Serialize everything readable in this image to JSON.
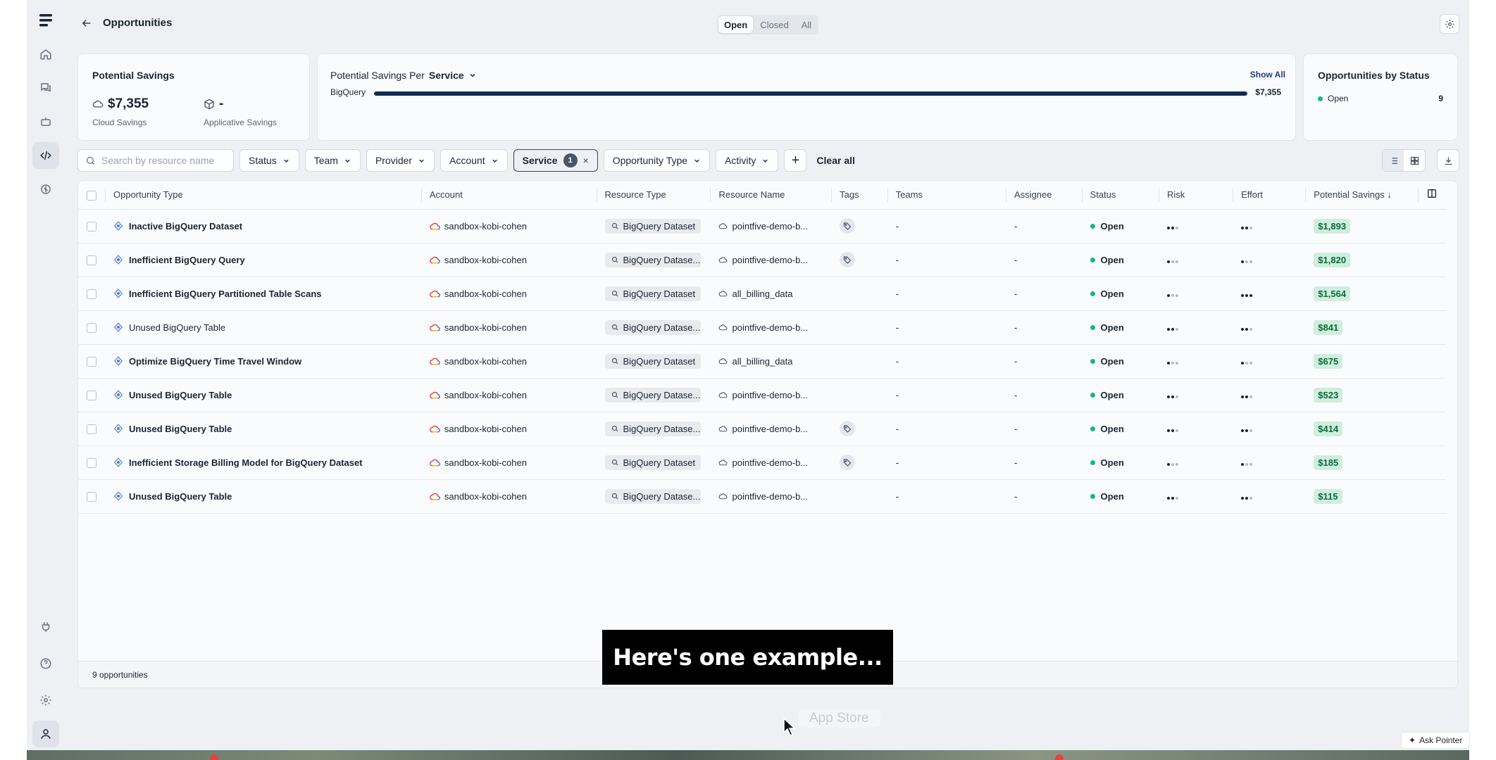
{
  "app": {
    "page_title": "Opportunities",
    "view_tabs": [
      {
        "label": "Open",
        "selected": true
      },
      {
        "label": "Closed",
        "selected": false
      },
      {
        "label": "All",
        "selected": false
      }
    ]
  },
  "potential_savings": {
    "title": "Potential Savings",
    "cloud_value": "$7,355",
    "cloud_label": "Cloud Savings",
    "applicative_value": "-",
    "applicative_label": "Applicative Savings"
  },
  "savings_per": {
    "title": "Potential Savings Per",
    "group_by": "Service",
    "show_all": "Show All",
    "bar": {
      "label": "BigQuery",
      "value": "$7,355",
      "fraction": 1.0
    }
  },
  "status_summary": {
    "title": "Opportunities by Status",
    "items": [
      {
        "label": "Open",
        "count": "9",
        "color": "#10b981"
      }
    ]
  },
  "filters": {
    "search_placeholder": "Search by resource name",
    "buttons": [
      "Status",
      "Team",
      "Provider",
      "Account"
    ],
    "active_filter": {
      "label": "Service",
      "count": "1",
      "remove": "×"
    },
    "more_buttons": [
      "Opportunity Type",
      "Activity"
    ],
    "add": "+",
    "clear_all": "Clear all"
  },
  "table": {
    "columns": [
      "Opportunity Type",
      "Account",
      "Resource Type",
      "Resource Name",
      "Tags",
      "Teams",
      "Assignee",
      "Status",
      "Risk",
      "Effort",
      "Potential Savings"
    ],
    "sort_indicator": "↓",
    "rows": [
      {
        "type": "Inactive BigQuery Dataset",
        "bold": true,
        "account": "sandbox-kobi-cohen",
        "resource_type": "BigQuery Dataset",
        "resource_name": "pointfive-demo-b...",
        "tag": true,
        "teams": "-",
        "assignee": "-",
        "status": "Open",
        "risk": 2,
        "effort": 2,
        "savings": "$1,893"
      },
      {
        "type": "Inefficient BigQuery Query",
        "bold": true,
        "account": "sandbox-kobi-cohen",
        "resource_type": "BigQuery Datase...",
        "resource_name": "pointfive-demo-b...",
        "tag": true,
        "teams": "-",
        "assignee": "-",
        "status": "Open",
        "risk": 1,
        "effort": 1,
        "savings": "$1,820"
      },
      {
        "type": "Inefficient BigQuery Partitioned Table Scans",
        "bold": true,
        "account": "sandbox-kobi-cohen",
        "resource_type": "BigQuery Dataset",
        "resource_name": "all_billing_data",
        "tag": false,
        "teams": "-",
        "assignee": "-",
        "status": "Open",
        "risk": 1,
        "effort": 3,
        "savings": "$1,564"
      },
      {
        "type": "Unused BigQuery Table",
        "bold": false,
        "account": "sandbox-kobi-cohen",
        "resource_type": "BigQuery Datase...",
        "resource_name": "pointfive-demo-b...",
        "tag": false,
        "teams": "-",
        "assignee": "-",
        "status": "Open",
        "risk": 2,
        "effort": 2,
        "savings": "$841"
      },
      {
        "type": "Optimize BigQuery Time Travel Window",
        "bold": true,
        "account": "sandbox-kobi-cohen",
        "resource_type": "BigQuery Dataset",
        "resource_name": "all_billing_data",
        "tag": false,
        "teams": "-",
        "assignee": "-",
        "status": "Open",
        "risk": 1,
        "effort": 1,
        "savings": "$675"
      },
      {
        "type": "Unused BigQuery Table",
        "bold": true,
        "account": "sandbox-kobi-cohen",
        "resource_type": "BigQuery Datase...",
        "resource_name": "pointfive-demo-b...",
        "tag": false,
        "teams": "-",
        "assignee": "-",
        "status": "Open",
        "risk": 2,
        "effort": 2,
        "savings": "$523"
      },
      {
        "type": "Unused BigQuery Table",
        "bold": true,
        "account": "sandbox-kobi-cohen",
        "resource_type": "BigQuery Datase...",
        "resource_name": "pointfive-demo-b...",
        "tag": true,
        "teams": "-",
        "assignee": "-",
        "status": "Open",
        "risk": 2,
        "effort": 2,
        "savings": "$414"
      },
      {
        "type": "Inefficient Storage Billing Model for BigQuery Dataset",
        "bold": true,
        "account": "sandbox-kobi-cohen",
        "resource_type": "BigQuery Dataset",
        "resource_name": "pointfive-demo-b...",
        "tag": true,
        "teams": "-",
        "assignee": "-",
        "status": "Open",
        "risk": 1,
        "effort": 1,
        "savings": "$185"
      },
      {
        "type": "Unused BigQuery Table",
        "bold": true,
        "account": "sandbox-kobi-cohen",
        "resource_type": "BigQuery Datase...",
        "resource_name": "pointfive-demo-b...",
        "tag": false,
        "teams": "-",
        "assignee": "-",
        "status": "Open",
        "risk": 2,
        "effort": 2,
        "savings": "$115"
      }
    ],
    "footer": "9 opportunities"
  },
  "overlay": {
    "caption": "Here's one example...",
    "app_store": "App Store",
    "ask_pointer": "Ask Pointer"
  },
  "colors": {
    "status_open": "#10b981",
    "savings_badge_bg": "#cfeedd",
    "savings_badge_text": "#0b6b3f",
    "bar_fill": "#0f2a55"
  },
  "icons": {
    "rail": [
      "home-icon",
      "chat-icon",
      "bot-icon",
      "code-icon",
      "lightbulb-icon",
      "plug-icon",
      "help-icon",
      "gear-icon",
      "user-icon"
    ]
  }
}
